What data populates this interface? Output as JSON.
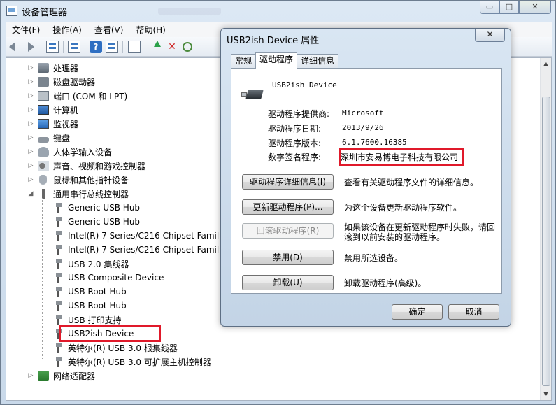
{
  "main_window": {
    "title": "设备管理器",
    "buttons": {
      "minimize": "▭",
      "maximize": "□",
      "close": "✕"
    }
  },
  "menu": [
    "文件(F)",
    "操作(A)",
    "查看(V)",
    "帮助(H)"
  ],
  "toolbar_icons": [
    "back-icon",
    "forward-icon",
    "view-icon",
    "properties-icon",
    "help-icon",
    "show-icon",
    "update-driver-icon",
    "uninstall-icon",
    "scan-icon"
  ],
  "tree": {
    "categories": [
      {
        "label": "处理器",
        "icon": "processor-icon"
      },
      {
        "label": "磁盘驱动器",
        "icon": "disk-icon"
      },
      {
        "label": "端口 (COM 和 LPT)",
        "icon": "port-icon"
      },
      {
        "label": "计算机",
        "icon": "computer-icon"
      },
      {
        "label": "监视器",
        "icon": "monitor-icon"
      },
      {
        "label": "键盘",
        "icon": "keyboard-icon"
      },
      {
        "label": "人体学输入设备",
        "icon": "hid-icon"
      },
      {
        "label": "声音、视频和游戏控制器",
        "icon": "sound-icon"
      },
      {
        "label": "鼠标和其他指针设备",
        "icon": "mouse-icon"
      },
      {
        "label": "通用串行总线控制器",
        "icon": "usb-controller-icon"
      }
    ],
    "usb_children": [
      "Generic USB Hub",
      "Generic USB Hub",
      "Intel(R) 7 Series/C216 Chipset Family USB",
      "Intel(R) 7 Series/C216 Chipset Family USB",
      "USB 2.0 集线器",
      "USB Composite Device",
      "USB Root Hub",
      "USB Root Hub",
      "USB 打印支持",
      "USB2ish Device",
      "英特尔(R) USB 3.0 根集线器",
      "英特尔(R) USB 3.0 可扩展主机控制器"
    ],
    "last_category": {
      "label": "网络适配器",
      "icon": "network-icon"
    },
    "expanded_marker": "◢",
    "collapsed_marker": "▷"
  },
  "dialog": {
    "title": "USB2ish Device 属性",
    "close": "✕",
    "tabs": [
      "常规",
      "驱动程序",
      "详细信息"
    ],
    "active_tab": "驱动程序",
    "device_name": "USB2ish Device",
    "info": [
      {
        "label": "驱动程序提供商:",
        "value": "Microsoft"
      },
      {
        "label": "驱动程序日期:",
        "value": "2013/9/26"
      },
      {
        "label": "驱动程序版本:",
        "value": "6.1.7600.16385"
      },
      {
        "label": "数字签名程序:",
        "value": "深圳市安易博电子科技有限公司"
      }
    ],
    "actions": [
      {
        "button": "驱动程序详细信息(I)",
        "desc": "查看有关驱动程序文件的详细信息。",
        "enabled": true
      },
      {
        "button": "更新驱动程序(P)...",
        "desc": "为这个设备更新驱动程序软件。",
        "enabled": true
      },
      {
        "button": "回滚驱动程序(R)",
        "desc": "如果该设备在更新驱动程序时失败，请回滚到以前安装的驱动程序。",
        "enabled": false
      },
      {
        "button": "禁用(D)",
        "desc": "禁用所选设备。",
        "enabled": true
      },
      {
        "button": "卸载(U)",
        "desc": "卸载驱动程序(高级)。",
        "enabled": true
      }
    ],
    "ok": "确定",
    "cancel": "取消"
  },
  "colors": {
    "highlight_border": "#e0192a",
    "window_frame": "#c9d9ea"
  }
}
